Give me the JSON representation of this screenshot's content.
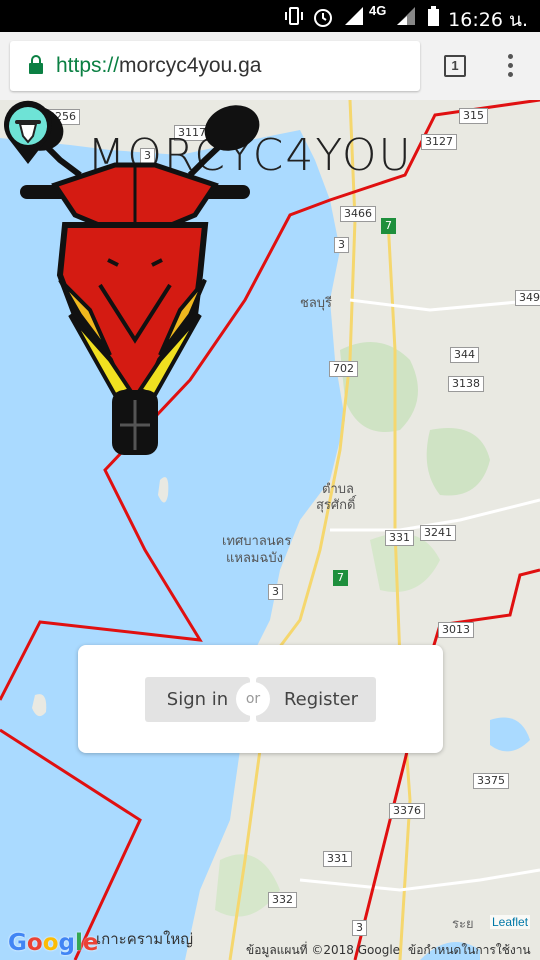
{
  "status_bar": {
    "network": "4G",
    "time": "16:26 น."
  },
  "browser": {
    "url_scheme": "https://",
    "url_host": "morcyc4you.ga",
    "tab_count": "1"
  },
  "app": {
    "brand_title": "MORCYC4YOU"
  },
  "map": {
    "route_shields": [
      {
        "label": "3256",
        "color": "white"
      },
      {
        "label": "3117",
        "color": "white"
      },
      {
        "label": "3",
        "color": "white"
      },
      {
        "label": "315",
        "color": "white"
      },
      {
        "label": "3127",
        "color": "white"
      },
      {
        "label": "3466",
        "color": "white"
      },
      {
        "label": "7",
        "color": "green"
      },
      {
        "label": "3",
        "color": "white"
      },
      {
        "label": "349",
        "color": "white"
      },
      {
        "label": "344",
        "color": "white"
      },
      {
        "label": "3138",
        "color": "white"
      },
      {
        "label": "702",
        "color": "white"
      },
      {
        "label": "331",
        "color": "white"
      },
      {
        "label": "3241",
        "color": "white"
      },
      {
        "label": "7",
        "color": "green"
      },
      {
        "label": "3",
        "color": "white"
      },
      {
        "label": "3013",
        "color": "white"
      },
      {
        "label": "3375",
        "color": "white"
      },
      {
        "label": "3376",
        "color": "white"
      },
      {
        "label": "331",
        "color": "white"
      },
      {
        "label": "332",
        "color": "white"
      },
      {
        "label": "3",
        "color": "white"
      }
    ],
    "place_labels": [
      "ชลบุรี",
      "ตำบล",
      "สุรศักดิ์",
      "เทศบาลนคร",
      "แหลมฉบัง"
    ],
    "bottom_place": "เกาะครามใหญ่",
    "rayong": "ระย",
    "leaflet": "Leaflet",
    "attribution": "ข้อมูลแผนที่ ©2018 Google",
    "terms": "ข้อกำหนดในการใช้งาน",
    "google_logo": "Google",
    "colors": {
      "water": "#aadaff",
      "land": "#e8e8e0",
      "zone_line": "#e01010"
    }
  },
  "login": {
    "signin_label": "Sign in",
    "or_label": "or",
    "register_label": "Register"
  }
}
